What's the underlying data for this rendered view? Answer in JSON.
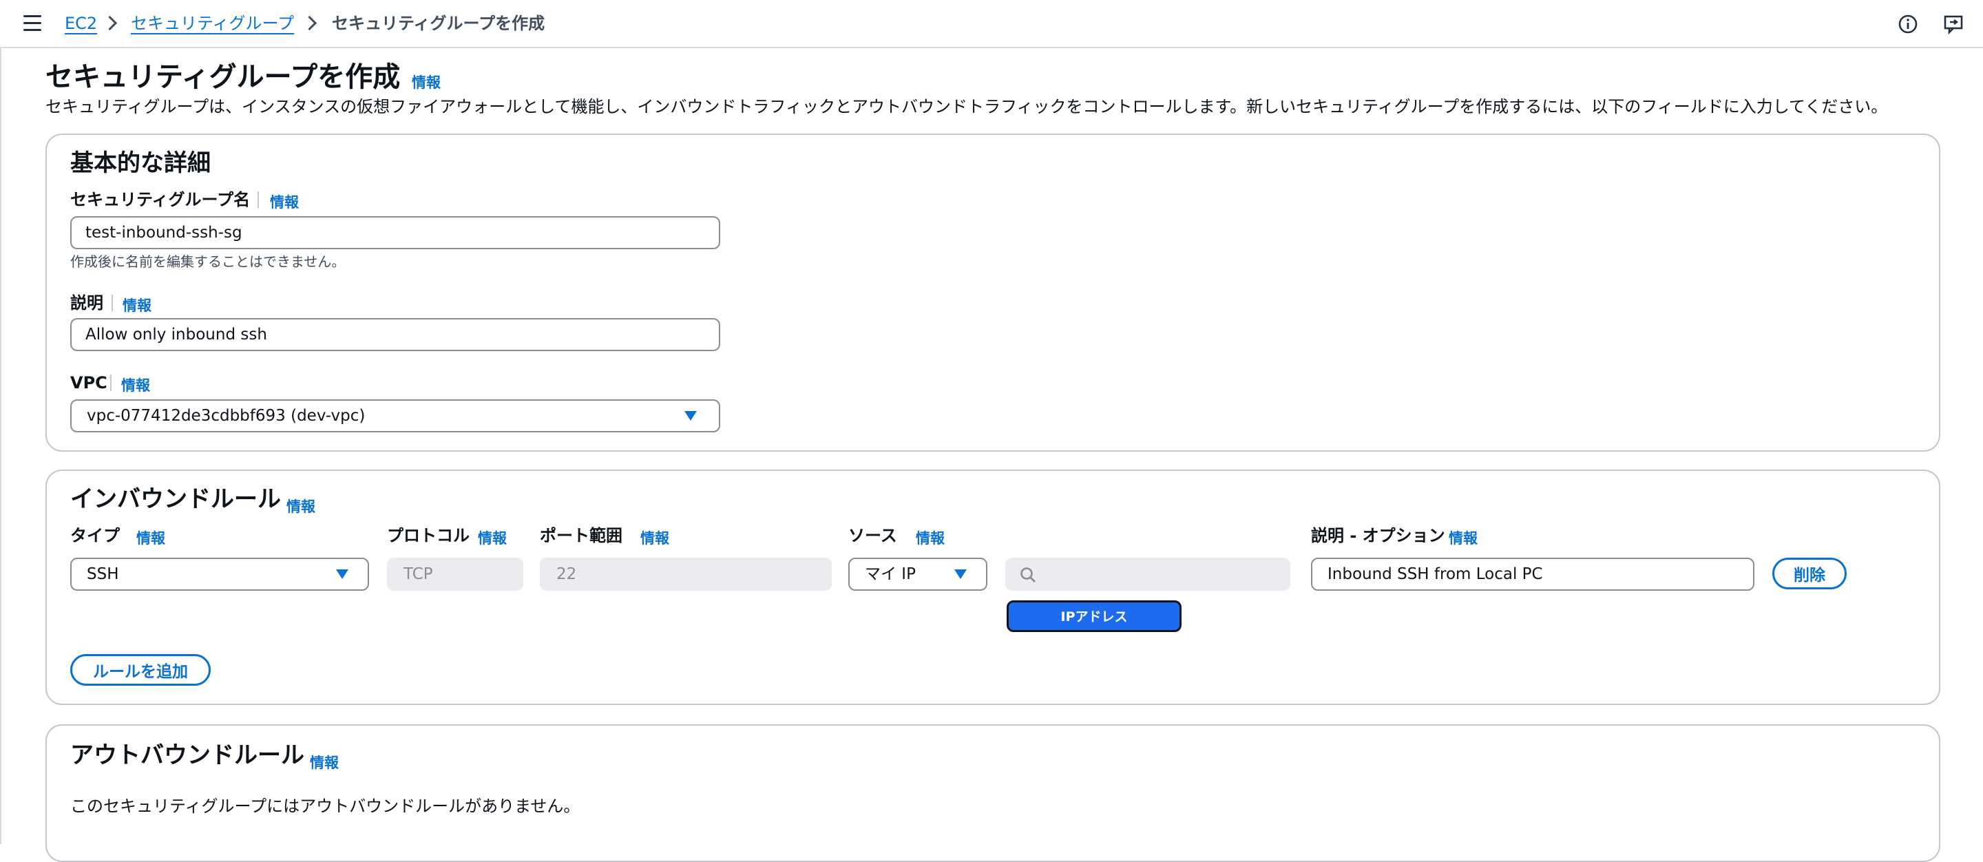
{
  "breadcrumb": {
    "items": [
      "EC2",
      "セキュリティグループ"
    ],
    "current": "セキュリティグループを作成"
  },
  "header": {
    "title": "セキュリティグループを作成",
    "info": "情報",
    "description": "セキュリティグループは、インスタンスの仮想ファイアウォールとして機能し、インバウンドトラフィックとアウトバウンドトラフィックをコントロールします。新しいセキュリティグループを作成するには、以下のフィールドに入力してください。"
  },
  "basic": {
    "title": "基本的な詳細",
    "name_label": "セキュリティグループ名",
    "name_info": "情報",
    "name_value": "test-inbound-ssh-sg",
    "name_help": "作成後に名前を編集することはできません。",
    "desc_label": "説明",
    "desc_info": "情報",
    "desc_value": "Allow only inbound ssh",
    "vpc_label": "VPC",
    "vpc_info": "情報",
    "vpc_value": "vpc-077412de3cdbbf693 (dev-vpc)"
  },
  "inbound": {
    "title": "インバウンドルール",
    "info": "情報",
    "columns": {
      "type": "タイプ",
      "protocol": "プロトコル",
      "port": "ポート範囲",
      "source": "ソース",
      "description": "説明 - オプション",
      "info": "情報"
    },
    "rule": {
      "type": "SSH",
      "protocol": "TCP",
      "port": "22",
      "source": "マイ IP",
      "search_value": "",
      "ip_button": "IPアドレス",
      "description": "Inbound SSH from Local PC",
      "delete": "削除"
    },
    "add_rule": "ルールを追加"
  },
  "outbound": {
    "title": "アウトバウンドルール",
    "info": "情報",
    "empty": "このセキュリティグループにはアウトバウンドルールがありません。"
  },
  "colors": {
    "accent": "#0972d3",
    "primary_button": "#1d6cf0",
    "border": "#c6c6cd"
  },
  "icons": [
    "menu-icon",
    "chevron-right-icon",
    "info-icon",
    "feedback-icon",
    "caret-down-icon",
    "search-icon"
  ]
}
